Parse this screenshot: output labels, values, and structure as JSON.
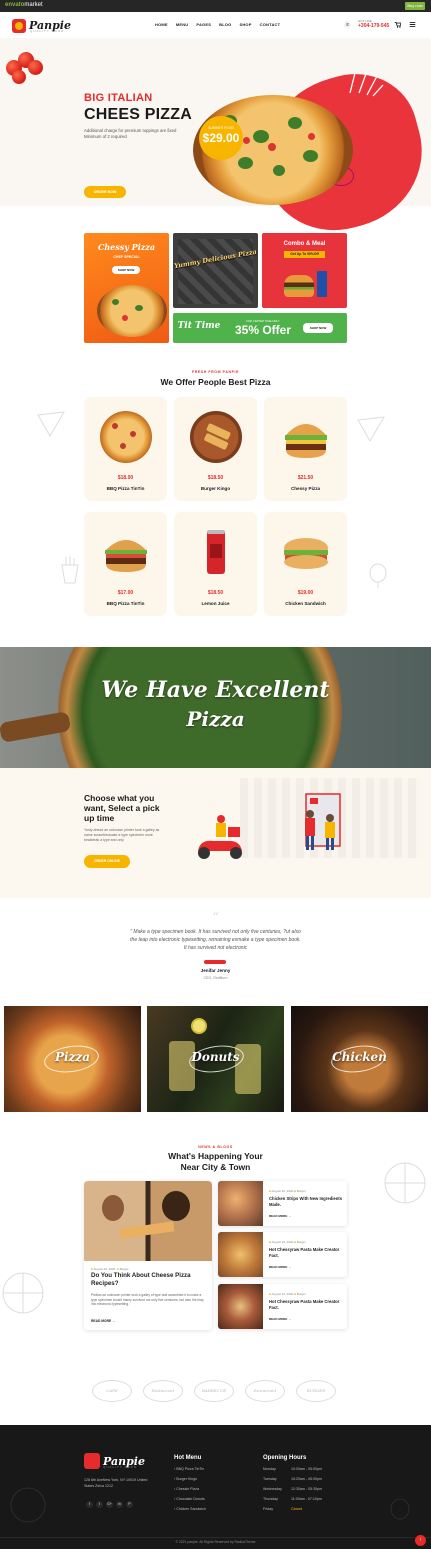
{
  "envato": {
    "brand": "envato",
    "market": "market",
    "buy": "Buy now"
  },
  "header": {
    "logo": "Panpie",
    "tagline": "QUALITY FOOD",
    "nav": [
      "HOME",
      "MENU",
      "PAGES",
      "BLOG",
      "SHOP",
      "CONTACT"
    ],
    "phone_label": "HOT LINE",
    "phone": "+304-179-545"
  },
  "hero": {
    "kicker": "BIG ITALIAN",
    "title": "CHEES PIZZA",
    "desc": "Additional charge for premium toppings are fixed Minimum of 2 required",
    "cta": "ORDER NOW",
    "badge_label": "SUMMER FOOD",
    "badge_price": "$29.00"
  },
  "promos": {
    "chessy": {
      "title": "Chessy Pizza",
      "sub": "CHEF SPECIAL",
      "btn": "SHOP NOW"
    },
    "yummy": {
      "title": "Yummy Delicious Pizza"
    },
    "combo": {
      "title": "Combo & Meal",
      "sub": "Get Up To 50%Off"
    },
    "offer": {
      "script": "Tit Time",
      "tag": "FOR LIMITED TIME ONLY",
      "title": "35% Offer",
      "btn": "SHOP NOW"
    }
  },
  "menu": {
    "tag": "FRESH FROM PANPIE",
    "title": "We Offer People Best Pizza",
    "items": [
      {
        "price": "$18.00",
        "name": "BBQ Pizza TinTin"
      },
      {
        "price": "$18.50",
        "name": "Burger Kingo"
      },
      {
        "price": "$21.50",
        "name": "Chessy Pizza"
      },
      {
        "price": "$17.00",
        "name": "BBQ Pizza TinTin"
      },
      {
        "price": "$18.50",
        "name": "Lemon Juice"
      },
      {
        "price": "$19.00",
        "name": "Chicken Sandwich"
      }
    ]
  },
  "banner": {
    "line1": "We Have Excellent",
    "line2": "Pizza"
  },
  "pickup": {
    "title": "Choose what you want, Select a pick up time",
    "desc": "Yusty ahead an unknown printer took a galley as name scrambleduake a type specimen more beakbeak a type and only",
    "btn": "ORDER ONLINE"
  },
  "testimonial": {
    "quote": "\" Make a type specimen book. It has survived not only five centuries, ?ut also the leap into electronic typesetting, remaining esmake a type specimen book. It has survived not electronic",
    "name": "Jenifar Jenny",
    "role": "CEO, RedBorn"
  },
  "categories": [
    "Pizza",
    "Donuts",
    "Chicken"
  ],
  "blog": {
    "tag": "NEWS & BLOGS",
    "title_1": "What's Happening Your",
    "title_2": "Near City & Town",
    "big": {
      "date": "August 16, 2020",
      "cat": "Burger",
      "title": "Do You Think About Cheese Pizza Recipes?",
      "excerpt": "Pixitlan an unknown printer took a galley of type and scrambled it to make a type specimen bookit hasey survived not only five centuries. but also the leap into electronic typesetting.",
      "read": "READ MORE"
    },
    "small": [
      {
        "date": "August 16, 2020",
        "cat": "Burger",
        "title": "Chicken Strips With New Ingredients Made.",
        "read": "READ MORE"
      },
      {
        "date": "August 16, 2020",
        "cat": "Burger",
        "title": "Hot Chessyraw Pasta Make Creator Fact.",
        "read": "READ MORE"
      },
      {
        "date": "August 16, 2020",
        "cat": "Burger",
        "title": "Hot Chessyraw Pasta Make Creator Fact.",
        "read": "READ MORE"
      }
    ]
  },
  "partners": [
    "CAFE",
    "Restaurant",
    "BARBECUE",
    "Restaurant",
    "BURGER"
  ],
  "footer": {
    "logo": "Panpie",
    "tagline": "QUALITY FOOD",
    "address": "128 6th AveNew York, NY 10019 United States Zeica 1212",
    "menu_title": "Hot Menu",
    "menu": [
      "BBQ Pizza TinTin",
      "Burger Kingo",
      "Chessie Pizza",
      "Chocolate Donuts",
      "Chicken Sandwich"
    ],
    "hours_title": "Opening Hours",
    "hours": [
      {
        "day": "Monday",
        "time": "10:00am - 05:00pm"
      },
      {
        "day": "Tuesday",
        "time": "10:20am - 05:00pm"
      },
      {
        "day": "Wednesday",
        "time": "12:30am - 05:30pm"
      },
      {
        "day": "Thursday",
        "time": "11:00am - 07:10pm"
      },
      {
        "day": "Friday",
        "time": "Closed"
      }
    ],
    "copyright": "© 2021 panpie. All Rights Reserved by RadiusTheme",
    "social": [
      "f",
      "t",
      "G+",
      "in",
      "P"
    ]
  },
  "colors": {
    "red": "#e52b2b",
    "yellow": "#f7b500",
    "green": "#5cb85c",
    "dark": "#181818",
    "cream": "#fdf6ea"
  }
}
